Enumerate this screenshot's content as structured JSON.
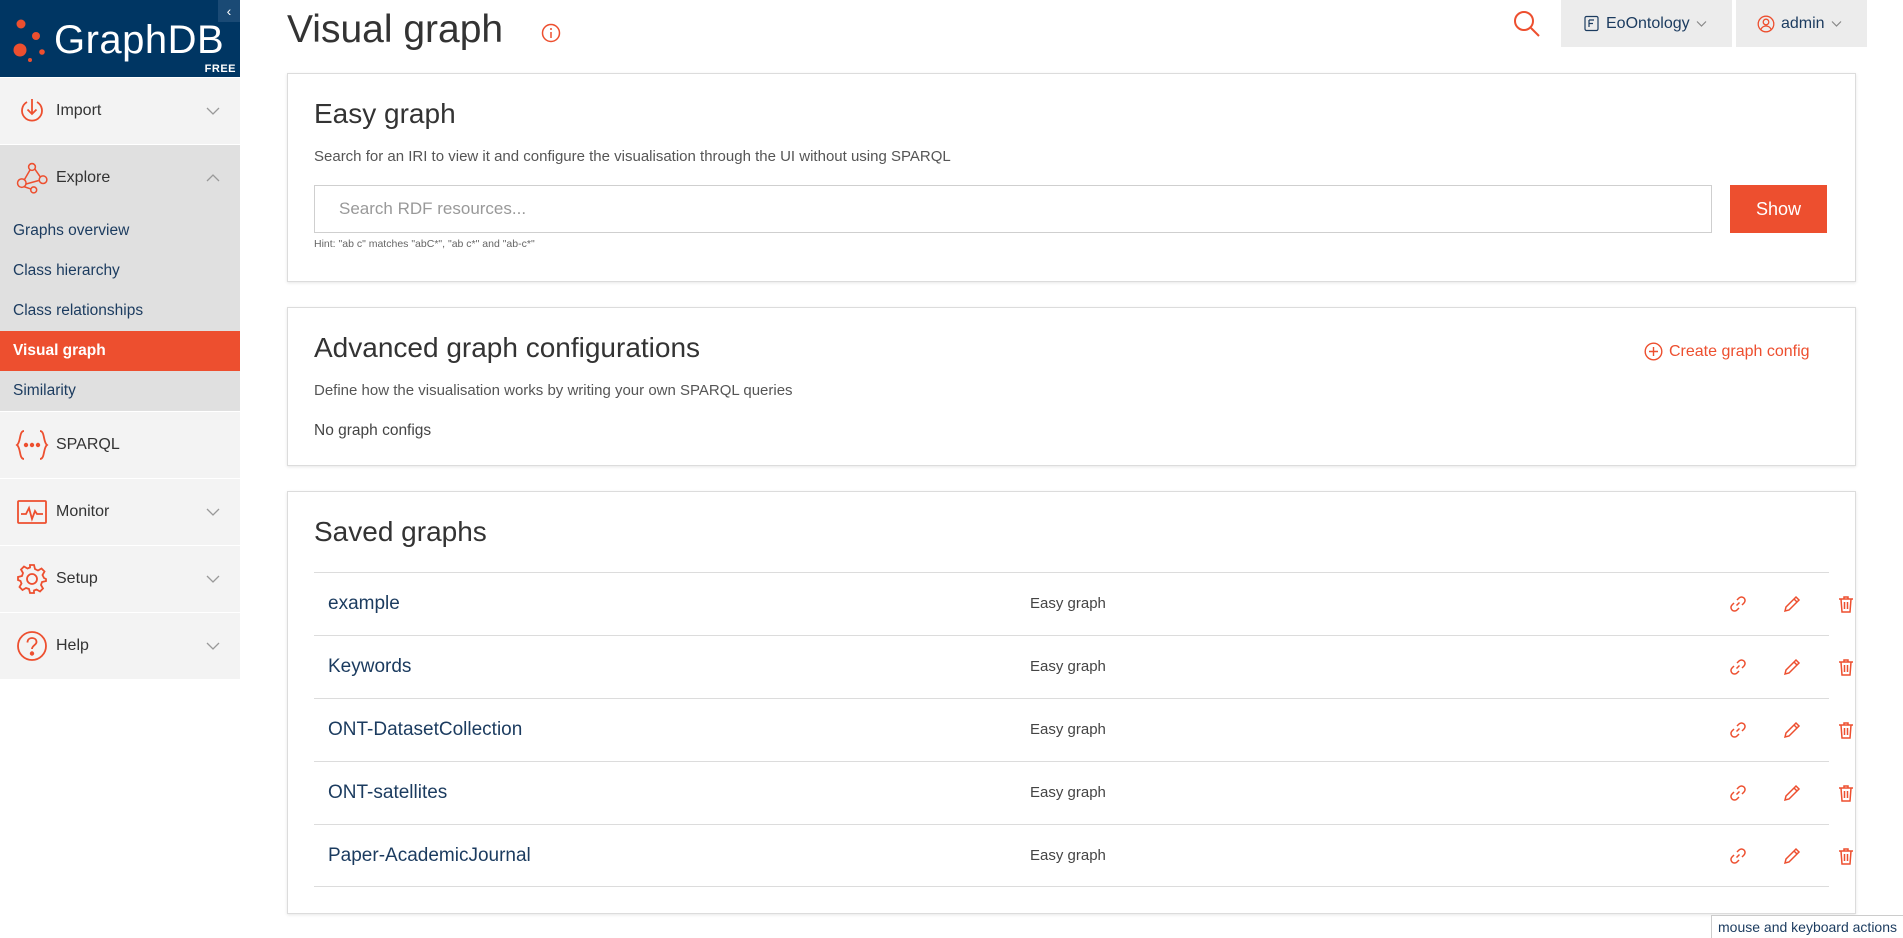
{
  "brand": {
    "name": "GraphDB",
    "edition": "FREE",
    "collapse_glyph": "‹",
    "accent": "#ed4f2f",
    "navy": "#003663"
  },
  "sidebar": {
    "items": [
      {
        "label": "Import",
        "icon": "import-icon"
      },
      {
        "label": "Explore",
        "icon": "explore-icon"
      },
      {
        "label": "SPARQL",
        "icon": "sparql-icon"
      },
      {
        "label": "Monitor",
        "icon": "monitor-icon"
      },
      {
        "label": "Setup",
        "icon": "setup-icon"
      },
      {
        "label": "Help",
        "icon": "help-icon"
      }
    ],
    "explore_submenu": [
      {
        "label": "Graphs overview"
      },
      {
        "label": "Class hierarchy"
      },
      {
        "label": "Class relationships"
      },
      {
        "label": "Visual graph",
        "active": true
      },
      {
        "label": "Similarity"
      }
    ]
  },
  "header": {
    "title": "Visual graph",
    "repository": "EoOntology",
    "user": "admin"
  },
  "easy_graph": {
    "title": "Easy graph",
    "description": "Search for an IRI to view it and configure the visualisation through the UI without using SPARQL",
    "search_placeholder": "Search RDF resources...",
    "show_label": "Show",
    "hint": "Hint: \"ab c\" matches \"abC*\", \"ab c*\" and \"ab-c*\""
  },
  "advanced": {
    "title": "Advanced graph configurations",
    "description": "Define how the visualisation works by writing your own SPARQL queries",
    "create_label": "Create graph config",
    "empty_text": "No graph configs"
  },
  "saved": {
    "title": "Saved graphs",
    "rows": [
      {
        "name": "example",
        "type": "Easy graph"
      },
      {
        "name": "Keywords",
        "type": "Easy graph"
      },
      {
        "name": "ONT-DatasetCollection",
        "type": "Easy graph"
      },
      {
        "name": "ONT-satellites",
        "type": "Easy graph"
      },
      {
        "name": "Paper-AcademicJournal",
        "type": "Easy graph"
      }
    ]
  },
  "footer": {
    "kbd_hint": "mouse and keyboard actions"
  }
}
